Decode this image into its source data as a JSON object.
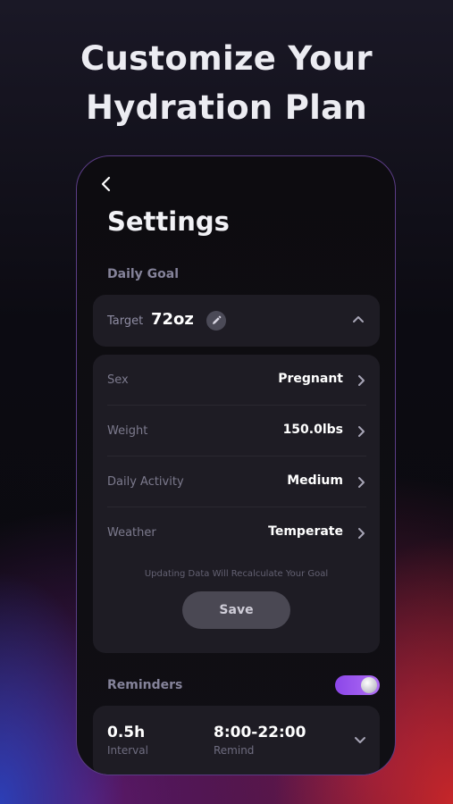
{
  "headline": {
    "line1": "Customize Your",
    "line2": "Hydration Plan"
  },
  "settings": {
    "title": "Settings",
    "back_icon": "chevron-left-icon",
    "daily_goal": {
      "section_label": "Daily Goal",
      "target_label": "Target",
      "target_value": "72oz",
      "edit_icon": "pencil-icon",
      "collapse_icon": "chevron-up-icon",
      "rows": [
        {
          "label": "Sex",
          "value": "Pregnant"
        },
        {
          "label": "Weight",
          "value": "150.0lbs"
        },
        {
          "label": "Daily Activity",
          "value": "Medium"
        },
        {
          "label": "Weather",
          "value": "Temperate"
        }
      ],
      "note": "Updating Data Will Recalculate Your Goal",
      "save_label": "Save"
    },
    "reminders": {
      "section_label": "Reminders",
      "enabled": true,
      "interval_value": "0.5h",
      "interval_label": "Interval",
      "remind_value": "8:00-22:00",
      "remind_label": "Remind",
      "expand_icon": "chevron-down-icon"
    }
  },
  "colors": {
    "accent": "#9b57ee",
    "card": "#1e1c24",
    "frame": "#5b3d86"
  }
}
